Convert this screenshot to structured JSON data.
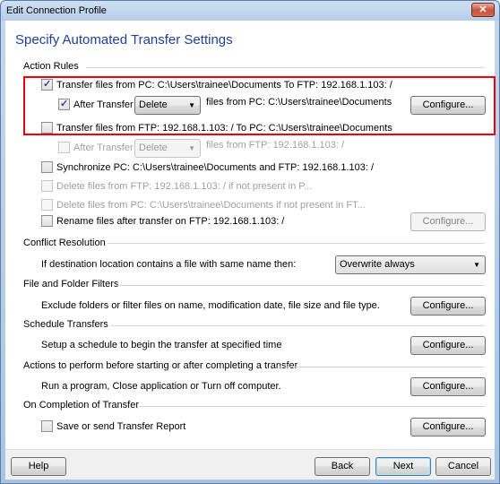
{
  "window": {
    "title": "Edit Connection Profile",
    "close_icon": "close-icon"
  },
  "page_title": "Specify Automated Transfer Settings",
  "action_rules": {
    "header": "Action Rules",
    "transfer_pc_to_ftp": {
      "checked": true,
      "label": "Transfer files from PC: C:\\Users\\trainee\\Documents  To  FTP: 192.168.1.103: /"
    },
    "after_transfer_1": {
      "checked": true,
      "label": "After Transfer",
      "select_value": "Delete",
      "suffix": "files from PC: C:\\Users\\trainee\\Documents",
      "configure_label": "Configure..."
    },
    "transfer_ftp_to_pc": {
      "checked": false,
      "label": "Transfer files from FTP: 192.168.1.103: /  To  PC: C:\\Users\\trainee\\Documents"
    },
    "after_transfer_2": {
      "checked": false,
      "disabled": true,
      "label": "After Transfer",
      "select_value": "Delete",
      "suffix": "files from FTP: 192.168.1.103: /"
    },
    "synchronize": {
      "checked": false,
      "label": "Synchronize PC: C:\\Users\\trainee\\Documents and FTP: 192.168.1.103: /"
    },
    "delete_ftp": {
      "checked": false,
      "disabled": true,
      "label": "Delete files from FTP: 192.168.1.103: / if not present in P..."
    },
    "delete_pc": {
      "checked": false,
      "disabled": true,
      "label": "Delete files from PC: C:\\Users\\trainee\\Documents if not present in FT..."
    },
    "rename": {
      "checked": false,
      "label": "Rename files after transfer on FTP: 192.168.1.103: /",
      "configure_label": "Configure..."
    }
  },
  "conflict_resolution": {
    "header": "Conflict Resolution",
    "label": "If destination location contains a file with same name then:",
    "select_value": "Overwrite always"
  },
  "file_filters": {
    "header": "File and Folder Filters",
    "label": "Exclude folders or filter files on name, modification date, file size and file type.",
    "configure_label": "Configure..."
  },
  "schedule": {
    "header": "Schedule Transfers",
    "label": "Setup a schedule to begin the transfer at specified time",
    "configure_label": "Configure..."
  },
  "actions": {
    "header": "Actions to perform before starting or after completing a transfer",
    "label": "Run a program, Close application or Turn off computer.",
    "configure_label": "Configure..."
  },
  "completion": {
    "header": "On Completion of Transfer",
    "label": "Save or send Transfer Report",
    "checked": false,
    "configure_label": "Configure..."
  },
  "footer": {
    "help": "Help",
    "back": "Back",
    "next": "Next",
    "cancel": "Cancel"
  },
  "colors": {
    "title_blue": "#1e3f9e",
    "highlight_red": "#e8000b"
  }
}
